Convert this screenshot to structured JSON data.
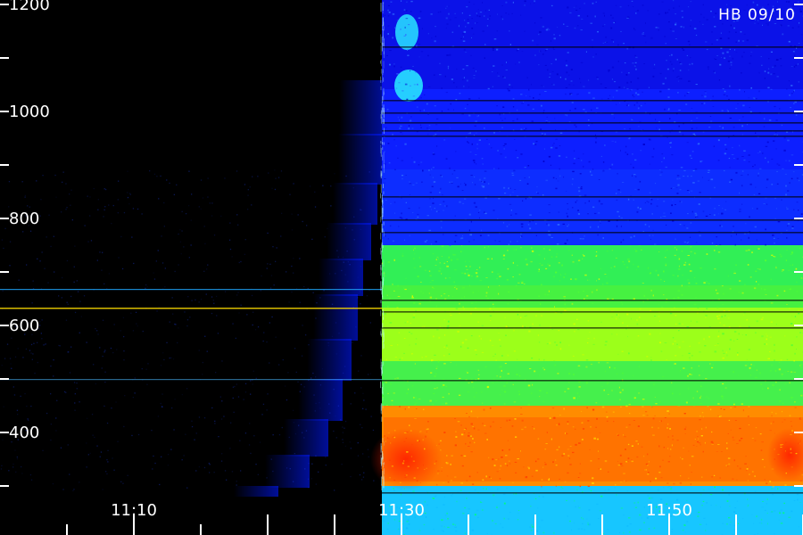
{
  "chart_data": {
    "type": "heatmap",
    "annotation": "HB 09/10",
    "y_ticks_major": [
      400,
      600,
      800,
      1000,
      1200
    ],
    "y_ticks_minor": [
      300,
      500,
      700,
      900,
      1100
    ],
    "y_tick_labels": [
      "400",
      "600",
      "800",
      "1000",
      "1200"
    ],
    "x_ticks_major": [
      "11:10",
      "11:30",
      "11:50"
    ],
    "x_tick_labels": [
      "11:10",
      "11:30",
      "11:50"
    ],
    "ylim": [
      300,
      1200
    ],
    "grid": false,
    "colormap": [
      "#000000",
      "#0a1cff",
      "#19c8ff",
      "#10f070",
      "#d8ff00",
      "#ff7a00",
      "#ff1500"
    ],
    "notes_visible": false
  }
}
